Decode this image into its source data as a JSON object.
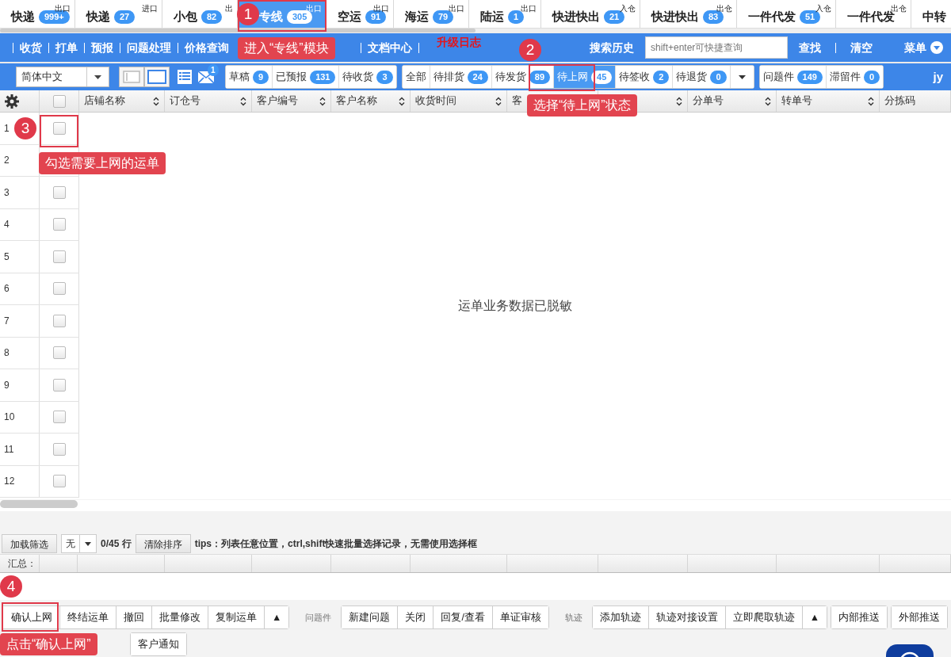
{
  "module_tabs": [
    {
      "label": "快递",
      "count": "999+",
      "note": "出口",
      "selected": false
    },
    {
      "label": "快递",
      "count": "27",
      "note": "进口",
      "selected": false
    },
    {
      "label": "小包",
      "count": "82",
      "note": "出",
      "selected": false
    },
    {
      "label": "专线",
      "count": "305",
      "note": "出口",
      "selected": true
    },
    {
      "label": "空运",
      "count": "91",
      "note": "出口",
      "selected": false
    },
    {
      "label": "海运",
      "count": "79",
      "note": "出口",
      "selected": false
    },
    {
      "label": "陆运",
      "count": "1",
      "note": "出口",
      "selected": false
    },
    {
      "label": "快进快出",
      "count": "21",
      "note": "入仓",
      "selected": false
    },
    {
      "label": "快进快出",
      "count": "83",
      "note": "出仓",
      "selected": false
    },
    {
      "label": "一件代发",
      "count": "51",
      "note": "入仓",
      "selected": false
    },
    {
      "label": "一件代发",
      "note": "出仓",
      "selected": false
    },
    {
      "label": "中转",
      "selected": false
    }
  ],
  "nav": {
    "items": [
      {
        "label": "收货",
        "kind": "normal"
      },
      {
        "label": "打单",
        "kind": "normal"
      },
      {
        "label": "预报",
        "kind": "normal"
      },
      {
        "label": "问题处理",
        "kind": "normal"
      },
      {
        "label": "价格查询",
        "kind": "normal"
      },
      {
        "label": "文档中心",
        "kind": "normal"
      },
      {
        "label": "升级日志",
        "kind": "alert"
      }
    ],
    "search_history": "搜索历史",
    "search": {
      "placeholder": "shift+enter可快捷查询"
    },
    "find": "查找",
    "clear": "清空",
    "menu": "菜单"
  },
  "toolbar": {
    "language": "简体中文",
    "mail_count": "1",
    "user": "jy",
    "status_groups": [
      [
        {
          "label": "草稿",
          "count": "9",
          "selected": false
        },
        {
          "label": "已预报",
          "count": "131",
          "selected": false
        },
        {
          "label": "待收货",
          "count": "3",
          "selected": false
        }
      ],
      [
        {
          "label": "全部",
          "selected": false
        },
        {
          "label": "待排货",
          "count": "24",
          "selected": false
        },
        {
          "label": "待发货",
          "count": "89",
          "selected": false
        },
        {
          "label": "待上网",
          "count": "45",
          "selected": true
        },
        {
          "label": "待签收",
          "count": "2",
          "selected": false
        },
        {
          "label": "待退货",
          "count": "0",
          "selected": false
        }
      ],
      [
        {
          "label": "问题件",
          "count": "149",
          "selected": false
        },
        {
          "label": "滞留件",
          "count": "0",
          "selected": false
        }
      ]
    ]
  },
  "table": {
    "columns": [
      {
        "label": "店铺名称",
        "sortable": true
      },
      {
        "label": "订仓号",
        "sortable": true
      },
      {
        "label": "客户编号",
        "sortable": true
      },
      {
        "label": "客户名称",
        "sortable": true
      },
      {
        "label": "收货时间",
        "sortable": true
      },
      {
        "label": "客"
      },
      {
        "sortable": true
      },
      {
        "label": "分单号",
        "sortable": true
      },
      {
        "label": "转单号",
        "sortable": true
      },
      {
        "label": "分拣码"
      }
    ],
    "select_all": {
      "checked": false
    },
    "rows": [
      {
        "number": "1",
        "checked": false
      },
      {
        "number": "2"
      },
      {
        "number": "3",
        "checked": false
      },
      {
        "number": "4",
        "checked": false
      },
      {
        "number": "5",
        "checked": false
      },
      {
        "number": "6",
        "checked": false
      },
      {
        "number": "7",
        "checked": false
      },
      {
        "number": "8",
        "checked": false
      },
      {
        "number": "9",
        "checked": false
      },
      {
        "number": "10",
        "checked": false
      },
      {
        "number": "11",
        "checked": false
      },
      {
        "number": "12",
        "checked": false
      }
    ],
    "empty_message": "运单业务数据已脱敏"
  },
  "footer": {
    "load_filter": "加载筛选",
    "filter_value": "无",
    "row_count": "0/45 行",
    "clear_sort": "清除排序",
    "tips": "tips：列表任意位置，ctrl,shift快速批量选择记录，无需使用选择框",
    "summary_label": "汇总："
  },
  "actions": [
    {
      "kind": "group",
      "items": [
        "确认上网",
        "终结运单",
        "撤回",
        "批量修改",
        "复制运单",
        "▲"
      ]
    },
    {
      "kind": "label",
      "text": "问题件"
    },
    {
      "kind": "group",
      "items": [
        "新建问题",
        "关闭",
        "回复/查看",
        "单证审核"
      ]
    },
    {
      "kind": "label",
      "text": "轨迹"
    },
    {
      "kind": "group",
      "items": [
        "添加轨迹",
        "轨迹对接设置",
        "立即爬取轨迹",
        "▲"
      ]
    },
    {
      "kind": "group",
      "items": [
        "内部推送"
      ]
    },
    {
      "kind": "group",
      "items": [
        "外部推送"
      ]
    },
    {
      "kind": "break"
    },
    {
      "kind": "group",
      "items": [
        "客户通知"
      ]
    }
  ],
  "annotations": [
    {
      "number": "1",
      "text": "进入“专线”模块"
    },
    {
      "number": "2",
      "text": "选择“待上网”状态"
    },
    {
      "number": "3",
      "text": "勾选需要上网的运单"
    },
    {
      "number": "4",
      "text": "点击“确认上网”"
    }
  ]
}
